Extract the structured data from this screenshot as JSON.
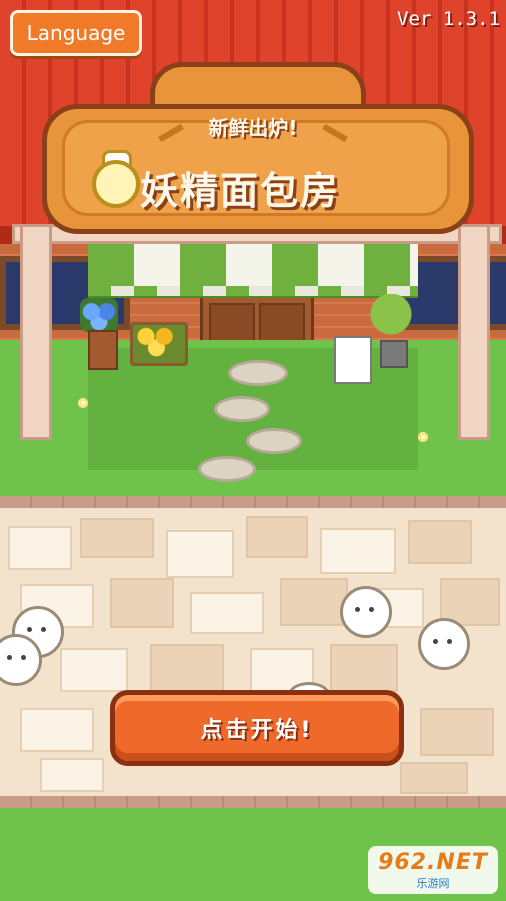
{
  "header": {
    "language_button_label": "Language",
    "version_text": "Ver 1.3.1"
  },
  "sign": {
    "subtitle": "新鲜出炉!",
    "title": "妖精面包房"
  },
  "start_button_label": "点击开始!",
  "watermark": {
    "logo_text": "962.NET",
    "sub_text": "乐游网"
  },
  "colors": {
    "roof_red": "#e0432b",
    "sign_orange": "#e8943a",
    "button_orange": "#ef6a2a",
    "grass_green": "#6fc24a"
  }
}
